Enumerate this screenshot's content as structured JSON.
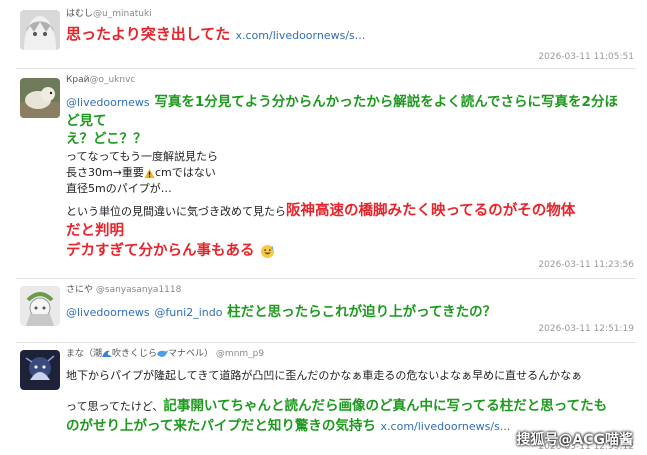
{
  "posts": [
    {
      "display_name": "はむし",
      "handle": "@u_minatuki",
      "text_red": "思ったより突き出してた",
      "link": "x.com/livedoornews/s...",
      "timestamp": "2026-03-11 11:05:51"
    },
    {
      "display_name": "Край",
      "handle": "@o_uknvc",
      "mention": "@livedoornews",
      "green_1": "写真を1分見てよう分からんかったから解説をよく読んでさらに写真を2分ほ",
      "green_2": "ど見て",
      "green_3": "え？どこ？？",
      "line_4": "ってなってもう一度解説見たら",
      "line_5a": "長さ30m→重要",
      "line_5b": "cmではない",
      "line_6": "直径5mのパイプが…",
      "line_7a": "という単位の見間違いに気づき改めて見たら",
      "red_7b": "阪神高速の橋脚みたく映ってるのがその物体",
      "red_8": "だと判明",
      "red_9": "デカすぎて分からん事もある",
      "timestamp": "2026-03-11 11:23:56"
    },
    {
      "display_name": "さにや",
      "handle": "@sanyasanya1118",
      "mention_1": "@livedoornews",
      "mention_2": "@funi2_indo",
      "green": "柱だと思ったらこれが迫り上がってきたの？",
      "timestamp": "2026-03-11 12:51:19"
    },
    {
      "display_name_a": "まな（潮",
      "display_name_b": "吹きくじら",
      "display_name_c": "マナベル）",
      "handle": "@mnm_p9",
      "line_1": "地下からパイプが隆起してきて道路が凸凹に歪んだのかなぁ車走るの危ないよなぁ早めに直せるんかなぁ",
      "line_2a": "って思ってたけど、",
      "green_2b": "記事開いてちゃんと読んだら画像のど真ん中に写ってる柱だと思ってたも",
      "green_3": "のがせり上がって来たパイプだと知り驚きの気持ち",
      "link": "x.com/livedoornews/s...",
      "timestamp": "2026-03-11 12:59:12"
    }
  ],
  "watermark": "搜狐号@ACG喵酱",
  "colors": {
    "red": "#e8242b",
    "green": "#1d9a1d",
    "link": "#2f6fb8"
  },
  "icons": [
    "warning-icon",
    "sweat-smile-icon",
    "wave-icon",
    "whale-icon"
  ]
}
